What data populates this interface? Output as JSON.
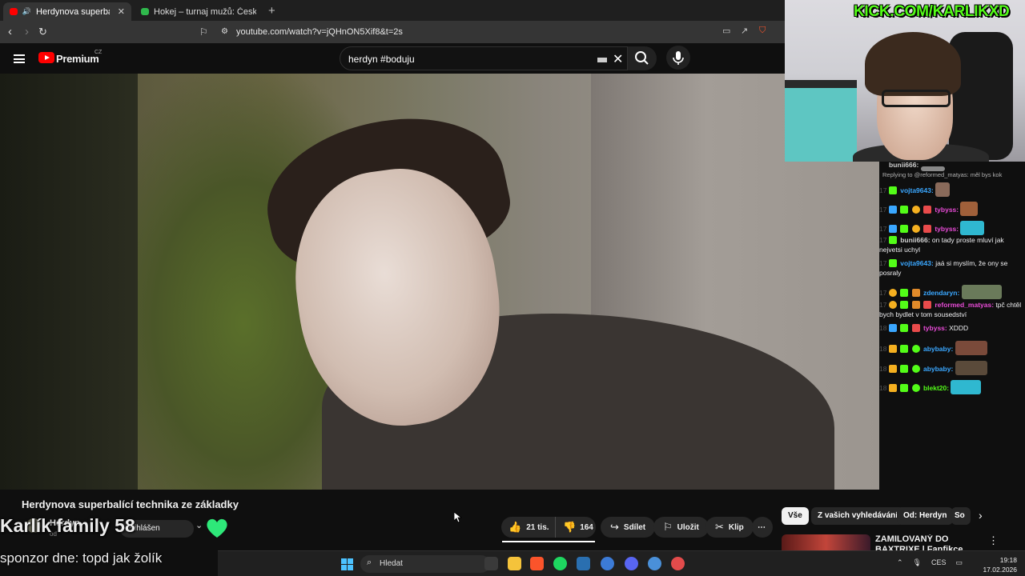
{
  "browser": {
    "tabs": [
      {
        "title": "Herdynova superbalící techni",
        "active": true
      },
      {
        "title": "Hokej – turnaj mužů: Česko – Dánsko",
        "active": false
      }
    ],
    "new_tab": "+",
    "url": "youtube.com/watch?v=jQHnON5Xif8&t=2s"
  },
  "youtube": {
    "logo_text": "Premium",
    "region": "CZ",
    "search_query": "herdyn #boduju"
  },
  "video": {
    "title": "Herdynova superbalící technika ze základky",
    "channel": "Herdyn",
    "channel_sub": "od",
    "subscribe_label": "Přihlášen",
    "likes": "21 tis.",
    "dislikes": "164",
    "share_label": "Sdílet",
    "save_label": "Uložit",
    "clip_label": "Klip",
    "more_label": "⋯"
  },
  "chips": [
    "Vše",
    "Z vašich vyhledávání",
    "Od: Herdyn",
    "So"
  ],
  "recommendation": {
    "title": "ZAMILOVANÝ DO BAXTRIXE | Fanfikce"
  },
  "overlay": {
    "kick": "KICK.COM/KARLIKXD",
    "family": "Karlík family 58",
    "sponsor": "sponzor dne: topd jak žolík"
  },
  "chat": {
    "messages": [
      {
        "time": "",
        "user": "bunii666:",
        "text": "",
        "color": "#cfcfcf"
      },
      {
        "time": "",
        "user": "",
        "text": "Replying to @reformed_matyas: měl bys kok",
        "color": "#888"
      },
      {
        "time": "17",
        "user": "vojta9643:",
        "text": "",
        "color": "#3aa7ff"
      },
      {
        "time": "17",
        "user": "tybyss:",
        "text": "",
        "color": "#e94bd7"
      },
      {
        "time": "17",
        "user": "tybyss:",
        "text": "",
        "color": "#e94bd7"
      },
      {
        "time": "17",
        "user": "bunii666:",
        "text": "on tady proste mluví jak nejvetsi uchyl",
        "color": "#cfcfcf"
      },
      {
        "time": "17",
        "user": "vojta9643:",
        "text": "jaá si myslím, že ony se posraly",
        "color": "#3aa7ff"
      },
      {
        "time": "17",
        "user": "zdendaryn:",
        "text": "",
        "color": "#3aa7ff"
      },
      {
        "time": "17",
        "user": "reformed_matyas:",
        "text": "tpč chtěl bych bydlet v tom sousedství",
        "color": "#e94bd7"
      },
      {
        "time": "18",
        "user": "tybyss:",
        "text": "XDDD",
        "color": "#e94bd7"
      },
      {
        "time": "18",
        "user": "abybaby:",
        "text": "",
        "color": "#3aa7ff"
      },
      {
        "time": "18",
        "user": "abybaby:",
        "text": "",
        "color": "#3aa7ff"
      },
      {
        "time": "18",
        "user": "blekt20:",
        "text": "",
        "color": "#53fc18"
      }
    ]
  },
  "taskbar": {
    "search_placeholder": "Hledat",
    "language": "CES",
    "time": "19:18",
    "date": "17.02.2026"
  }
}
